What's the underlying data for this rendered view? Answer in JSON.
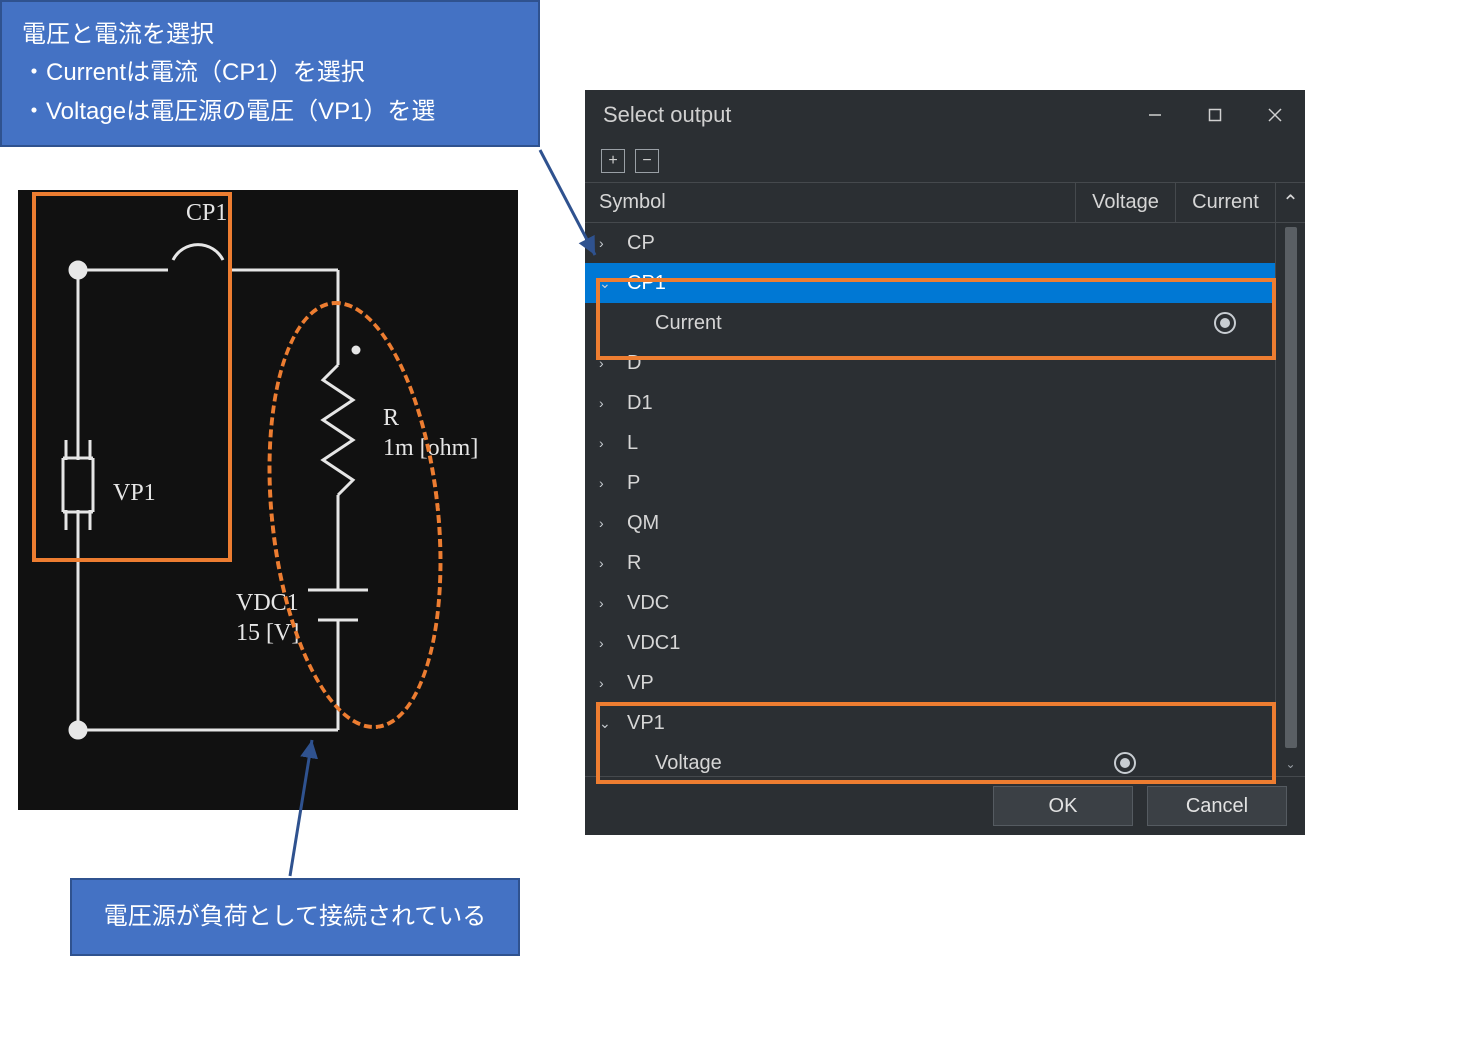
{
  "callout_top": {
    "line1": "電圧と電流を選択",
    "line2": "・Currentは電流（CP1）を選択",
    "line3": "・Voltageは電圧源の電圧（VP1）を選"
  },
  "callout_bottom": {
    "text": "電圧源が負荷として接続されている"
  },
  "circuit": {
    "cp1_label": "CP1",
    "vp1_label": "VP1",
    "r_label": "R",
    "r_value": "1m [ohm]",
    "vdc_label": "VDC1",
    "vdc_value": "15 [V]"
  },
  "dialog": {
    "title": "Select output",
    "expand_label": "+",
    "collapse_label": "−",
    "header_symbol": "Symbol",
    "header_voltage": "Voltage",
    "header_current": "Current",
    "ok_label": "OK",
    "cancel_label": "Cancel",
    "tree": {
      "cp": {
        "label": "CP",
        "expanded": false
      },
      "cp1": {
        "label": "CP1",
        "expanded": true,
        "child_label": "Current",
        "selected_column": "current"
      },
      "d": {
        "label": "D",
        "expanded": false
      },
      "d1": {
        "label": "D1",
        "expanded": false
      },
      "l": {
        "label": "L",
        "expanded": false
      },
      "p": {
        "label": "P",
        "expanded": false
      },
      "qm": {
        "label": "QM",
        "expanded": false
      },
      "r": {
        "label": "R",
        "expanded": false
      },
      "vdc": {
        "label": "VDC",
        "expanded": false
      },
      "vdc1": {
        "label": "VDC1",
        "expanded": false
      },
      "vp": {
        "label": "VP",
        "expanded": false
      },
      "vp1": {
        "label": "VP1",
        "expanded": true,
        "child_label": "Voltage",
        "selected_column": "voltage"
      }
    }
  }
}
